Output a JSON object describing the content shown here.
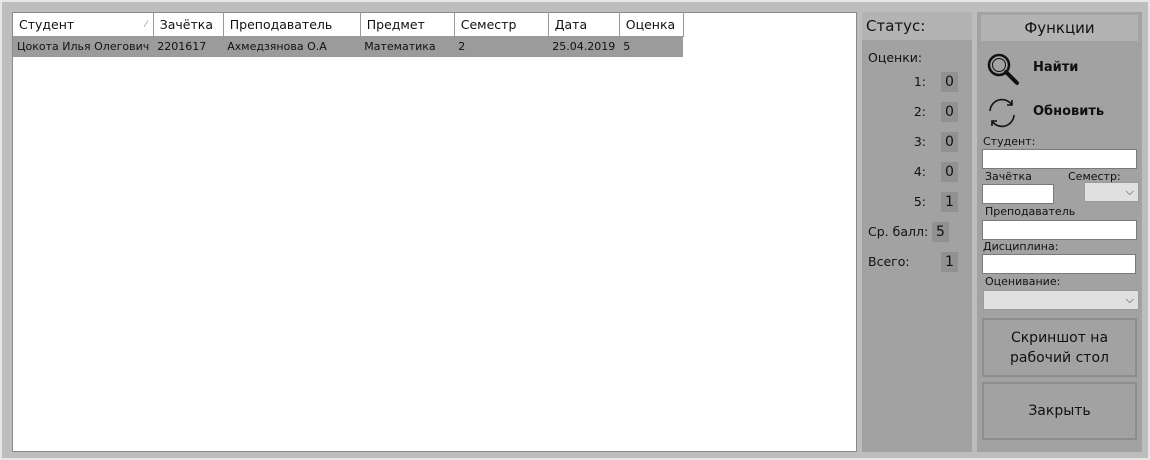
{
  "table": {
    "columns": [
      "Студент",
      "Зачётка",
      "Преподаватель",
      "Предмет",
      "Семестр",
      "Дата",
      "Оценка"
    ],
    "rows": [
      [
        "Цокота Илья Олегович",
        "2201617",
        "Ахмедзянова О.А",
        "Математика",
        "2",
        "25.04.2019",
        "5"
      ]
    ]
  },
  "status": {
    "title": "Статус:",
    "grades_label": "Оценки:",
    "grades": [
      {
        "key": "1:",
        "value": "0"
      },
      {
        "key": "2:",
        "value": "0"
      },
      {
        "key": "3:",
        "value": "0"
      },
      {
        "key": "4:",
        "value": "0"
      },
      {
        "key": "5:",
        "value": "1"
      }
    ],
    "avg_label": "Ср. балл:",
    "avg_value": "5",
    "total_label": "Всего:",
    "total_value": "1"
  },
  "functions": {
    "title": "Функции",
    "find_label": "Найти",
    "refresh_label": "Обновить",
    "student_label": "Студент:",
    "student_value": "",
    "zachetka_label": "Зачётка",
    "zachetka_value": "",
    "semester_label": "Семестр:",
    "semester_value": "",
    "teacher_label": "Преподаватель",
    "teacher_value": "",
    "discipline_label": "Дисциплина:",
    "discipline_value": "",
    "grading_label": "Оценивание:",
    "grading_value": "",
    "screenshot_line1": "Скриншот на",
    "screenshot_line2": "рабочий стол",
    "close_label": "Закрыть"
  }
}
